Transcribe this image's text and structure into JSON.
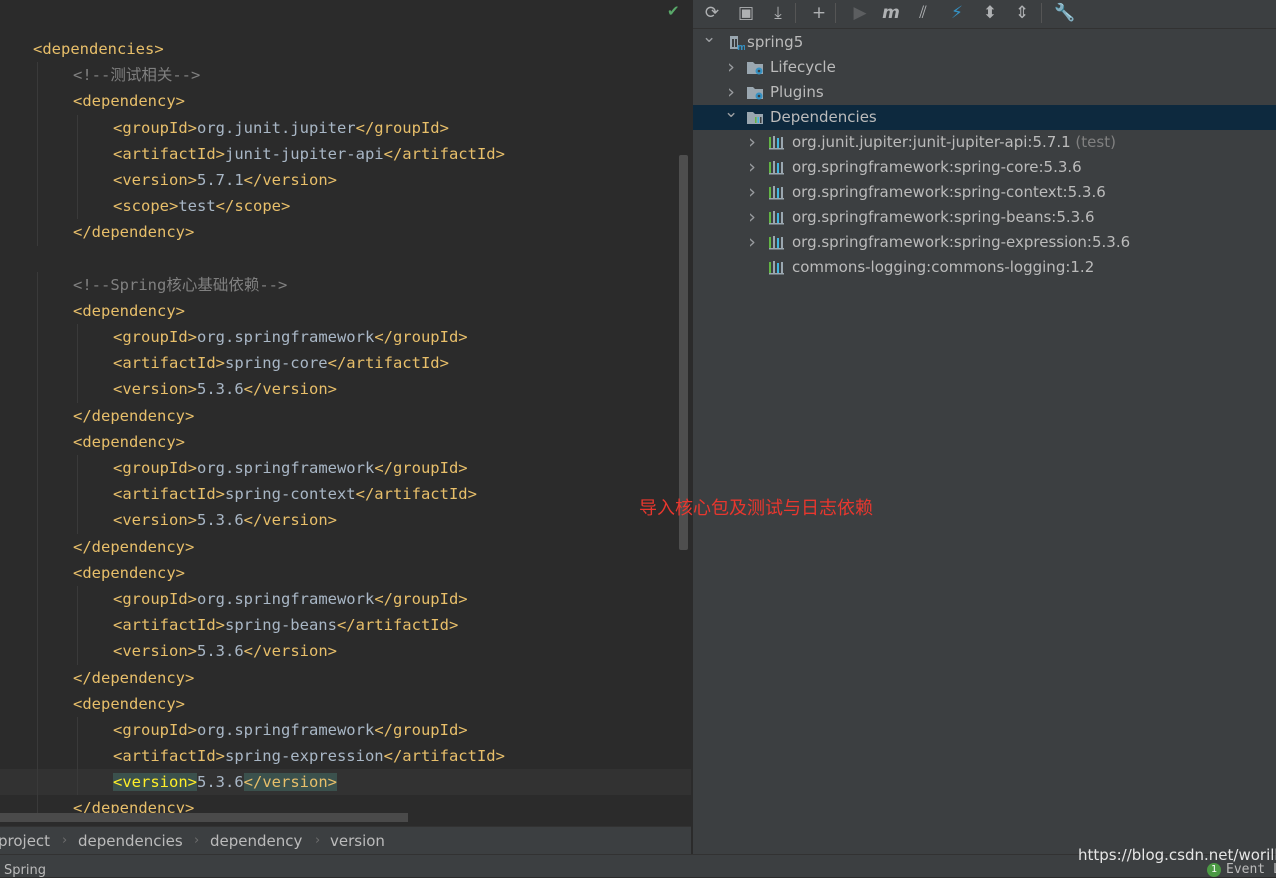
{
  "editor": {
    "status_check": "✔",
    "lines": [
      {
        "indent": 0,
        "tokens": [
          {
            "t": "tag",
            "v": "<dependencies>"
          }
        ]
      },
      {
        "indent": 1,
        "tokens": [
          {
            "t": "comment",
            "v": "<!--测试相关-->"
          }
        ]
      },
      {
        "indent": 1,
        "tokens": [
          {
            "t": "tag",
            "v": "<dependency>"
          }
        ]
      },
      {
        "indent": 2,
        "tokens": [
          {
            "t": "tag",
            "v": "<groupId>"
          },
          {
            "t": "text",
            "v": "org.junit.jupiter"
          },
          {
            "t": "tag",
            "v": "</groupId>"
          }
        ]
      },
      {
        "indent": 2,
        "tokens": [
          {
            "t": "tag",
            "v": "<artifactId>"
          },
          {
            "t": "text",
            "v": "junit-jupiter-api"
          },
          {
            "t": "tag",
            "v": "</artifactId>"
          }
        ]
      },
      {
        "indent": 2,
        "tokens": [
          {
            "t": "tag",
            "v": "<version>"
          },
          {
            "t": "text",
            "v": "5.7.1"
          },
          {
            "t": "tag",
            "v": "</version>"
          }
        ]
      },
      {
        "indent": 2,
        "tokens": [
          {
            "t": "tag",
            "v": "<scope>"
          },
          {
            "t": "text",
            "v": "test"
          },
          {
            "t": "tag",
            "v": "</scope>"
          }
        ]
      },
      {
        "indent": 1,
        "tokens": [
          {
            "t": "tag",
            "v": "</dependency>"
          }
        ]
      },
      {
        "indent": 0,
        "tokens": []
      },
      {
        "indent": 1,
        "tokens": [
          {
            "t": "comment",
            "v": "<!--Spring核心基础依赖-->"
          }
        ]
      },
      {
        "indent": 1,
        "tokens": [
          {
            "t": "tag",
            "v": "<dependency>"
          }
        ]
      },
      {
        "indent": 2,
        "tokens": [
          {
            "t": "tag",
            "v": "<groupId>"
          },
          {
            "t": "text",
            "v": "org.springframework"
          },
          {
            "t": "tag",
            "v": "</groupId>"
          }
        ]
      },
      {
        "indent": 2,
        "tokens": [
          {
            "t": "tag",
            "v": "<artifactId>"
          },
          {
            "t": "text",
            "v": "spring-core"
          },
          {
            "t": "tag",
            "v": "</artifactId>"
          }
        ]
      },
      {
        "indent": 2,
        "tokens": [
          {
            "t": "tag",
            "v": "<version>"
          },
          {
            "t": "text",
            "v": "5.3.6"
          },
          {
            "t": "tag",
            "v": "</version>"
          }
        ]
      },
      {
        "indent": 1,
        "tokens": [
          {
            "t": "tag",
            "v": "</dependency>"
          }
        ]
      },
      {
        "indent": 1,
        "tokens": [
          {
            "t": "tag",
            "v": "<dependency>"
          }
        ]
      },
      {
        "indent": 2,
        "tokens": [
          {
            "t": "tag",
            "v": "<groupId>"
          },
          {
            "t": "text",
            "v": "org.springframework"
          },
          {
            "t": "tag",
            "v": "</groupId>"
          }
        ]
      },
      {
        "indent": 2,
        "tokens": [
          {
            "t": "tag",
            "v": "<artifactId>"
          },
          {
            "t": "text",
            "v": "spring-context"
          },
          {
            "t": "tag",
            "v": "</artifactId>"
          }
        ]
      },
      {
        "indent": 2,
        "tokens": [
          {
            "t": "tag",
            "v": "<version>"
          },
          {
            "t": "text",
            "v": "5.3.6"
          },
          {
            "t": "tag",
            "v": "</version>"
          }
        ]
      },
      {
        "indent": 1,
        "tokens": [
          {
            "t": "tag",
            "v": "</dependency>"
          }
        ]
      },
      {
        "indent": 1,
        "tokens": [
          {
            "t": "tag",
            "v": "<dependency>"
          }
        ]
      },
      {
        "indent": 2,
        "tokens": [
          {
            "t": "tag",
            "v": "<groupId>"
          },
          {
            "t": "text",
            "v": "org.springframework"
          },
          {
            "t": "tag",
            "v": "</groupId>"
          }
        ]
      },
      {
        "indent": 2,
        "tokens": [
          {
            "t": "tag",
            "v": "<artifactId>"
          },
          {
            "t": "text",
            "v": "spring-beans"
          },
          {
            "t": "tag",
            "v": "</artifactId>"
          }
        ]
      },
      {
        "indent": 2,
        "tokens": [
          {
            "t": "tag",
            "v": "<version>"
          },
          {
            "t": "text",
            "v": "5.3.6"
          },
          {
            "t": "tag",
            "v": "</version>"
          }
        ]
      },
      {
        "indent": 1,
        "tokens": [
          {
            "t": "tag",
            "v": "</dependency>"
          }
        ]
      },
      {
        "indent": 1,
        "tokens": [
          {
            "t": "tag",
            "v": "<dependency>"
          }
        ]
      },
      {
        "indent": 2,
        "tokens": [
          {
            "t": "tag",
            "v": "<groupId>"
          },
          {
            "t": "text",
            "v": "org.springframework"
          },
          {
            "t": "tag",
            "v": "</groupId>"
          }
        ]
      },
      {
        "indent": 2,
        "tokens": [
          {
            "t": "tag",
            "v": "<artifactId>"
          },
          {
            "t": "text",
            "v": "spring-expression"
          },
          {
            "t": "tag",
            "v": "</artifactId>"
          }
        ]
      },
      {
        "indent": 2,
        "current": true,
        "tokens": [
          {
            "t": "hl-open",
            "v": "<version>"
          },
          {
            "t": "text",
            "v": "5.3.6"
          },
          {
            "t": "hl",
            "v": "</version>"
          }
        ]
      },
      {
        "indent": 1,
        "tokens": [
          {
            "t": "tag",
            "v": "</dependency>"
          }
        ]
      }
    ]
  },
  "breadcrumb": {
    "items": [
      "project",
      "dependencies",
      "dependency",
      "version"
    ],
    "separator": "›"
  },
  "maven": {
    "toolbar": [
      {
        "name": "reload-icon",
        "glyph": "⟳"
      },
      {
        "name": "generate-sources-icon",
        "glyph": "▣"
      },
      {
        "name": "download-icon",
        "glyph": "⤓"
      },
      {
        "name": "add-icon",
        "glyph": "+"
      },
      {
        "name": "run-icon",
        "glyph": "▶"
      },
      {
        "name": "execute-goal-icon",
        "glyph": "m"
      },
      {
        "name": "toggle-offline-icon",
        "glyph": "⫽"
      },
      {
        "name": "skip-tests-icon",
        "glyph": "⚡"
      },
      {
        "name": "show-dependencies-icon",
        "glyph": "⬍"
      },
      {
        "name": "collapse-all-icon",
        "glyph": "⇕"
      },
      {
        "name": "settings-wrench-icon",
        "glyph": "🔧"
      }
    ],
    "tree": [
      {
        "label": "spring5",
        "level": 0,
        "arrow": "expanded",
        "icon": "maven-project-icon"
      },
      {
        "label": "Lifecycle",
        "level": 1,
        "arrow": "collapsed",
        "icon": "lifecycle-folder-icon"
      },
      {
        "label": "Plugins",
        "level": 1,
        "arrow": "collapsed",
        "icon": "plugins-folder-icon"
      },
      {
        "label": "Dependencies",
        "level": 1,
        "arrow": "expanded",
        "icon": "dependencies-folder-icon",
        "selected": true
      },
      {
        "label": "org.junit.jupiter:junit-jupiter-api:5.7.1",
        "scope": "(test)",
        "level": 2,
        "arrow": "collapsed",
        "icon": "library-icon"
      },
      {
        "label": "org.springframework:spring-core:5.3.6",
        "level": 2,
        "arrow": "collapsed",
        "icon": "library-icon"
      },
      {
        "label": "org.springframework:spring-context:5.3.6",
        "level": 2,
        "arrow": "collapsed",
        "icon": "library-icon"
      },
      {
        "label": "org.springframework:spring-beans:5.3.6",
        "level": 2,
        "arrow": "collapsed",
        "icon": "library-icon"
      },
      {
        "label": "org.springframework:spring-expression:5.3.6",
        "level": 2,
        "arrow": "collapsed",
        "icon": "library-icon"
      },
      {
        "label": "commons-logging:commons-logging:1.2",
        "level": 2,
        "arrow": "none",
        "icon": "library-icon"
      }
    ]
  },
  "annotation": "导入核心包及测试与日志依赖",
  "status": {
    "left_text": "Spring",
    "event_log_count": "1",
    "event_log_label": "Event Lo"
  },
  "watermark": "https://blog.csdn.net/worilb",
  "colors": {
    "editor_bg": "#2b2b2b",
    "panel_bg": "#3c3f41",
    "xml_tag": "#e8bf6a",
    "comment": "#808080",
    "text": "#a9b7c6",
    "selection": "#0d293e",
    "annotation": "#e8372e"
  }
}
